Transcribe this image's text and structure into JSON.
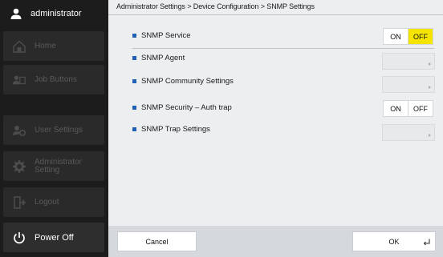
{
  "sidebar": {
    "user_name": "administrator",
    "items": [
      {
        "label": "Home",
        "icon": "home-icon"
      },
      {
        "label": "Job Buttons",
        "icon": "job-buttons-icon"
      },
      {
        "label": "User Settings",
        "icon": "user-settings-icon"
      },
      {
        "label": "Administrator Setting",
        "icon": "gear-icon"
      },
      {
        "label": "Logout",
        "icon": "logout-icon"
      }
    ],
    "power_label": "Power Off"
  },
  "breadcrumb": "Administrator Settings > Device Configuration > SNMP Settings",
  "settings": {
    "snmp_service": {
      "label": "SNMP Service",
      "on_label": "ON",
      "off_label": "OFF",
      "selected": "OFF"
    },
    "snmp_agent": {
      "label": "SNMP Agent"
    },
    "snmp_community": {
      "label": "SNMP Community Settings"
    },
    "snmp_security": {
      "label": "SNMP Security – Auth trap",
      "on_label": "ON",
      "off_label": "OFF"
    },
    "snmp_trap": {
      "label": "SNMP Trap Settings"
    }
  },
  "footer": {
    "cancel_label": "Cancel",
    "ok_label": "OK"
  },
  "colors": {
    "accent_yellow": "#f5e400",
    "bullet_blue": "#1f5fb4",
    "sidebar_bg": "#1c1c1c"
  }
}
